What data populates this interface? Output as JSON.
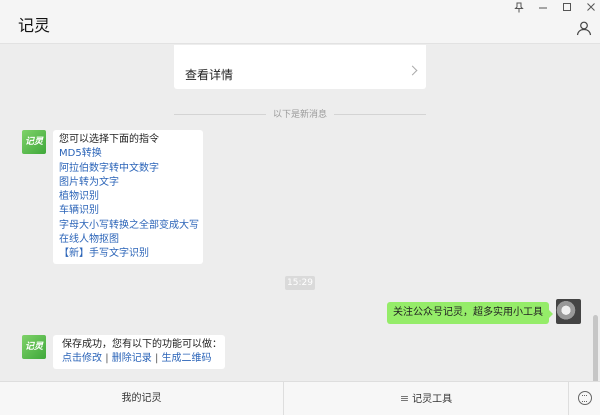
{
  "window": {
    "title": "记灵",
    "controls": {
      "pin": "pin-icon",
      "minimize": "minimize-icon",
      "maximize": "maximize-icon",
      "close": "close-icon"
    }
  },
  "chat": {
    "card": {
      "label": "查看详情"
    },
    "divider_text": "以下是新消息",
    "avatar_text": "记灵",
    "command_message": {
      "header": "您可以选择下面的指令",
      "commands": [
        "MD5转换",
        "阿拉伯数字转中文数字",
        "图片转为文字",
        "植物识别",
        "车辆识别",
        "字母大小写转换之全部变成大写",
        "在线人物抠图",
        "【新】手写文字识别"
      ]
    },
    "timestamp": "15:29",
    "outgoing_message": "关注公众号记灵，超多实用小工具",
    "save_message": {
      "header": "保存成功，您有以下的功能可以做：",
      "actions": [
        "点击修改",
        "删除记录",
        "生成二维码"
      ],
      "separator": "|"
    }
  },
  "bottombar": {
    "tabs": [
      {
        "label": "我的记灵"
      },
      {
        "label": "记灵工具",
        "icon": "≡"
      }
    ]
  },
  "colors": {
    "accent_green": "#95ec69",
    "link_blue": "#2b64b8",
    "background": "#ededed"
  }
}
